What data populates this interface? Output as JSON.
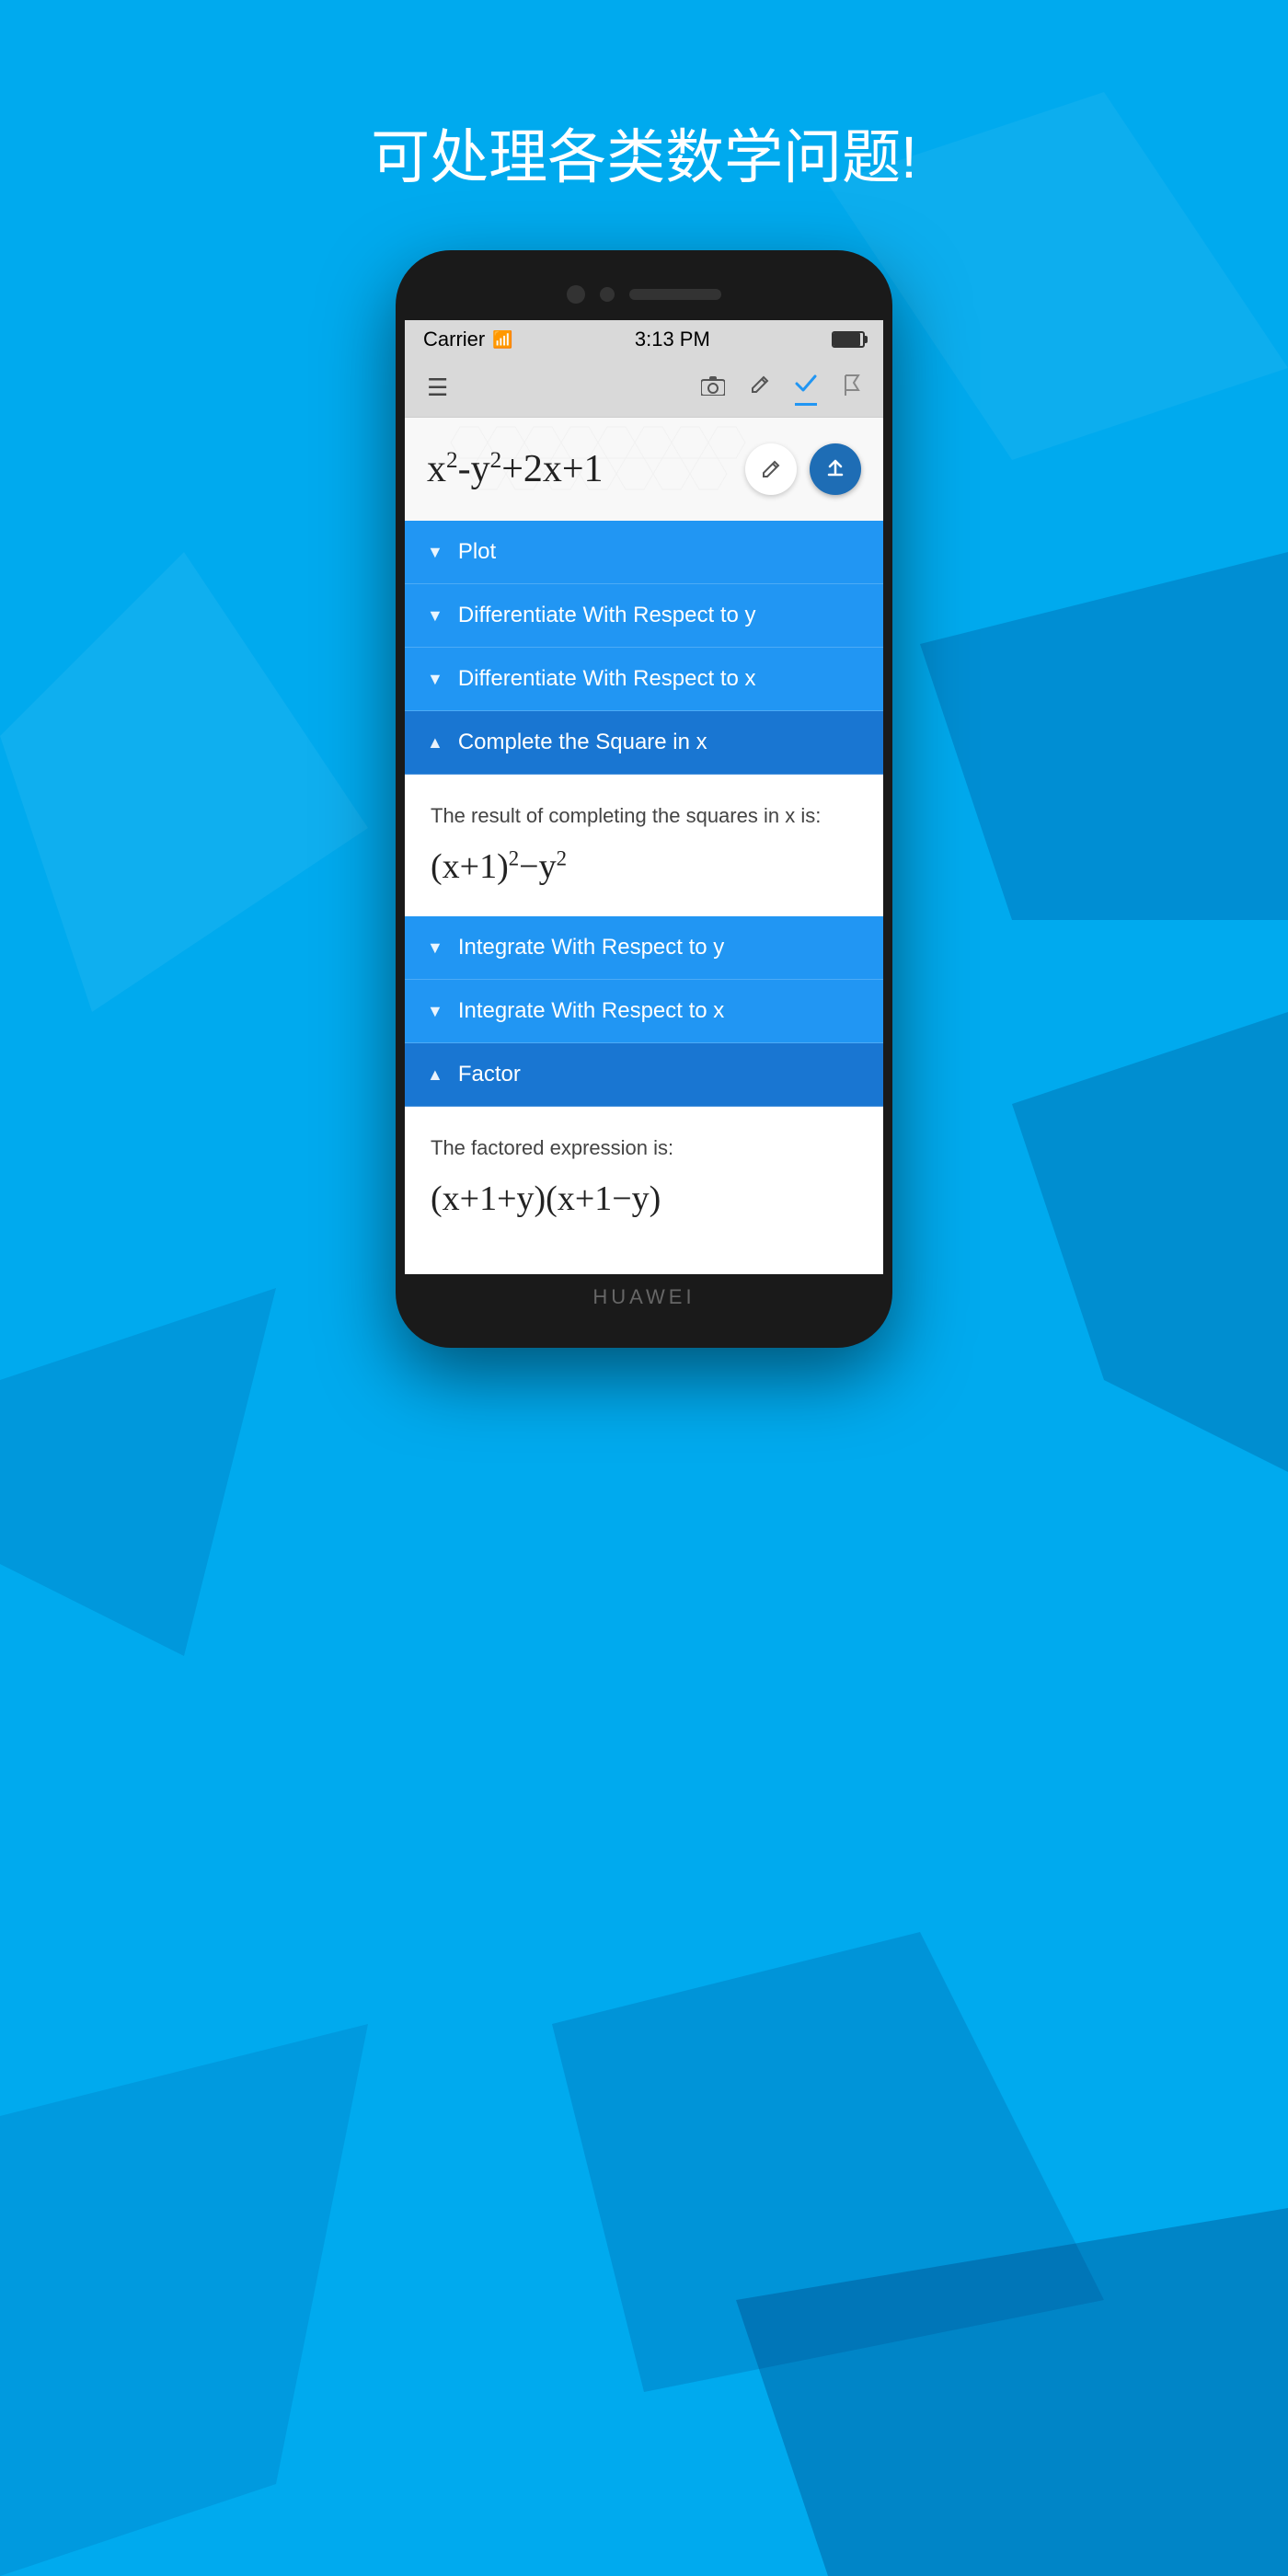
{
  "page": {
    "title": "可处理各类数学问题!",
    "background_color": "#00aaee"
  },
  "phone": {
    "brand": "HUAWEI",
    "status_bar": {
      "carrier": "Carrier",
      "time": "3:13 PM"
    },
    "toolbar": {
      "menu_label": "≡",
      "camera_label": "📷",
      "pencil_label": "✏",
      "check_label": "✓",
      "flag_label": "⚑"
    },
    "expression": {
      "value": "x²-y²+2x+1",
      "edit_button": "✏",
      "upload_button": "↑"
    },
    "menu_items": [
      {
        "id": "plot",
        "label": "Plot",
        "chevron": "▼",
        "expanded": false
      },
      {
        "id": "diff-y",
        "label": "Differentiate With Respect to y",
        "chevron": "▼",
        "expanded": false
      },
      {
        "id": "diff-x",
        "label": "Differentiate With Respect to x",
        "chevron": "▼",
        "expanded": false
      },
      {
        "id": "complete-square",
        "label": "Complete the Square in x",
        "chevron": "▲",
        "expanded": true
      },
      {
        "id": "integrate-y",
        "label": "Integrate With Respect to y",
        "chevron": "▼",
        "expanded": false
      },
      {
        "id": "integrate-x",
        "label": "Integrate With Respect to x",
        "chevron": "▼",
        "expanded": false
      },
      {
        "id": "factor",
        "label": "Factor",
        "chevron": "▲",
        "expanded": true
      }
    ],
    "panels": {
      "complete-square": {
        "subtitle": "The result of completing the squares in x is:",
        "result": "(x+1)²−y²"
      },
      "factor": {
        "subtitle": "The factored expression is:",
        "result": "(x+1+y)(x+1−y)"
      }
    }
  }
}
